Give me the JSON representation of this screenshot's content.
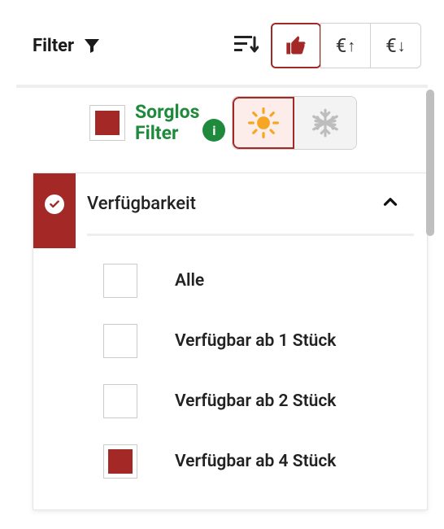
{
  "toolbar": {
    "filter_label": "Filter"
  },
  "sort": {
    "sort_icon": "sort-descending",
    "options": [
      {
        "name": "thumbs-up",
        "selected": true
      },
      {
        "name": "price-asc",
        "symbol": "€",
        "arrow": "↑",
        "selected": false
      },
      {
        "name": "price-desc",
        "symbol": "€",
        "arrow": "↓",
        "selected": false
      }
    ]
  },
  "sorglos": {
    "swatch_color": "#a32826",
    "label_line1": "Sorglos",
    "label_line2": "Filter",
    "info_icon": "i",
    "season": {
      "summer_selected": true,
      "winter_selected": false
    }
  },
  "section": {
    "title": "Verfügbarkeit",
    "expanded": true,
    "badge_active": true,
    "options": [
      {
        "label": "Alle",
        "checked": false
      },
      {
        "label": "Verfügbar ab 1 Stück",
        "checked": false
      },
      {
        "label": "Verfügbar ab 2 Stück",
        "checked": false
      },
      {
        "label": "Verfügbar ab 4 Stück",
        "checked": true
      }
    ]
  }
}
